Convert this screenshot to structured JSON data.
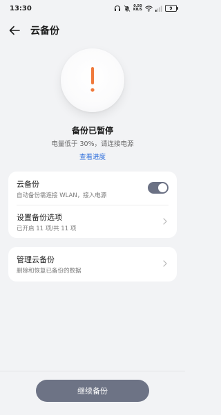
{
  "status_bar": {
    "time": "13:30",
    "net_speed_value": "0.50",
    "net_speed_unit": "KB/S",
    "battery": "9",
    "icons": [
      "headphones-icon",
      "mute-icon",
      "net-speed-icon",
      "wifi-icon",
      "signal-icon",
      "battery-icon"
    ]
  },
  "header": {
    "title": "云备份",
    "back_icon": "arrow-left-icon"
  },
  "status": {
    "icon": "exclamation-icon",
    "accent_color": "#f07a3c",
    "title": "备份已暂停",
    "description": "电量低于 30%，请连接电源",
    "link": "查看进度",
    "link_color": "#2f6fdc"
  },
  "settings": {
    "cloud_backup": {
      "title": "云备份",
      "subtitle": "自动备份需连接 WLAN，接入电源",
      "toggle_on": true
    },
    "backup_options": {
      "title": "设置备份选项",
      "subtitle": "已开启 11 项/共 11 项"
    },
    "manage": {
      "title": "管理云备份",
      "subtitle": "删除和恢复已备份的数据"
    }
  },
  "footer": {
    "continue_label": "继续备份",
    "button_color": "#6d7385"
  }
}
